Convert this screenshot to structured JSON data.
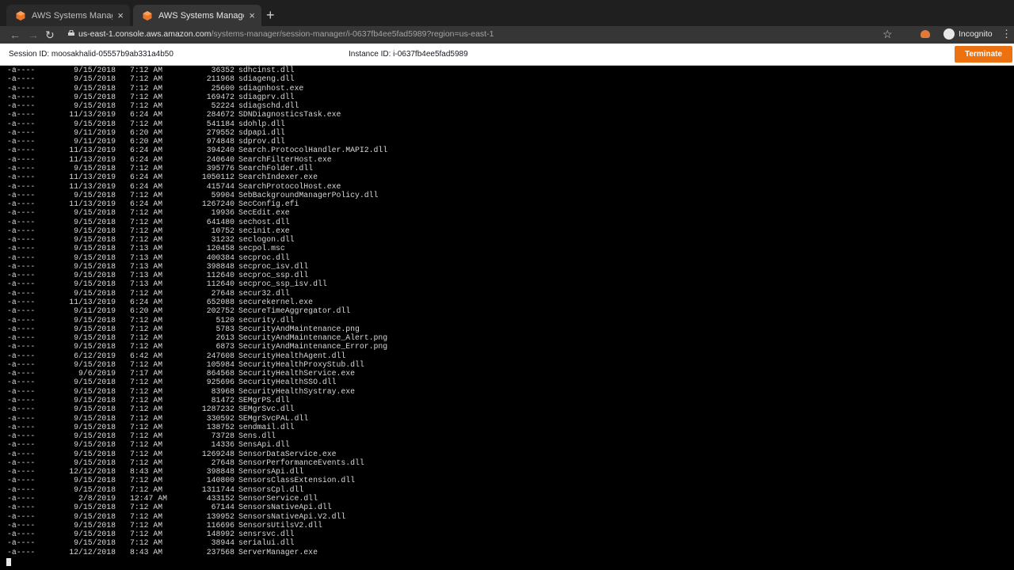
{
  "browser": {
    "tabs": [
      {
        "title": "AWS Systems Manager - Sessi"
      },
      {
        "title": "AWS Systems Manager - Sessi"
      }
    ],
    "new_tab": "+",
    "url_host": "us-east-1.console.aws.amazon.com",
    "url_path": "/systems-manager/session-manager/i-0637fb4ee5fad5989?region=us-east-1",
    "incognito_label": "Incognito"
  },
  "session": {
    "session_label": "Session ID: moosakhalid-05557b9ab331a4b50",
    "instance_label": "Instance ID: i-0637fb4ee5fad5989",
    "terminate_label": "Terminate",
    "accent_color": "#ec7211"
  },
  "terminal": {
    "rows": [
      {
        "mode": "-a----",
        "date": "9/15/2018",
        "time": "7:12 AM",
        "size": "36352",
        "name": "sdhcinst.dll"
      },
      {
        "mode": "-a----",
        "date": "9/15/2018",
        "time": "7:12 AM",
        "size": "211968",
        "name": "sdiageng.dll"
      },
      {
        "mode": "-a----",
        "date": "9/15/2018",
        "time": "7:12 AM",
        "size": "25600",
        "name": "sdiagnhost.exe"
      },
      {
        "mode": "-a----",
        "date": "9/15/2018",
        "time": "7:12 AM",
        "size": "169472",
        "name": "sdiagprv.dll"
      },
      {
        "mode": "-a----",
        "date": "9/15/2018",
        "time": "7:12 AM",
        "size": "52224",
        "name": "sdiagschd.dll"
      },
      {
        "mode": "-a----",
        "date": "11/13/2019",
        "time": "6:24 AM",
        "size": "284672",
        "name": "SDNDiagnosticsTask.exe"
      },
      {
        "mode": "-a----",
        "date": "9/15/2018",
        "time": "7:12 AM",
        "size": "541184",
        "name": "sdohlp.dll"
      },
      {
        "mode": "-a----",
        "date": "9/11/2019",
        "time": "6:20 AM",
        "size": "279552",
        "name": "sdpapi.dll"
      },
      {
        "mode": "-a----",
        "date": "9/11/2019",
        "time": "6:20 AM",
        "size": "974848",
        "name": "sdprov.dll"
      },
      {
        "mode": "-a----",
        "date": "11/13/2019",
        "time": "6:24 AM",
        "size": "394240",
        "name": "Search.ProtocolHandler.MAPI2.dll"
      },
      {
        "mode": "-a----",
        "date": "11/13/2019",
        "time": "6:24 AM",
        "size": "240640",
        "name": "SearchFilterHost.exe"
      },
      {
        "mode": "-a----",
        "date": "9/15/2018",
        "time": "7:12 AM",
        "size": "395776",
        "name": "SearchFolder.dll"
      },
      {
        "mode": "-a----",
        "date": "11/13/2019",
        "time": "6:24 AM",
        "size": "1050112",
        "name": "SearchIndexer.exe"
      },
      {
        "mode": "-a----",
        "date": "11/13/2019",
        "time": "6:24 AM",
        "size": "415744",
        "name": "SearchProtocolHost.exe"
      },
      {
        "mode": "-a----",
        "date": "9/15/2018",
        "time": "7:12 AM",
        "size": "59904",
        "name": "SebBackgroundManagerPolicy.dll"
      },
      {
        "mode": "-a----",
        "date": "11/13/2019",
        "time": "6:24 AM",
        "size": "1267240",
        "name": "SecConfig.efi"
      },
      {
        "mode": "-a----",
        "date": "9/15/2018",
        "time": "7:12 AM",
        "size": "19936",
        "name": "SecEdit.exe"
      },
      {
        "mode": "-a----",
        "date": "9/15/2018",
        "time": "7:12 AM",
        "size": "641480",
        "name": "sechost.dll"
      },
      {
        "mode": "-a----",
        "date": "9/15/2018",
        "time": "7:12 AM",
        "size": "10752",
        "name": "secinit.exe"
      },
      {
        "mode": "-a----",
        "date": "9/15/2018",
        "time": "7:12 AM",
        "size": "31232",
        "name": "seclogon.dll"
      },
      {
        "mode": "-a----",
        "date": "9/15/2018",
        "time": "7:13 AM",
        "size": "120458",
        "name": "secpol.msc"
      },
      {
        "mode": "-a----",
        "date": "9/15/2018",
        "time": "7:13 AM",
        "size": "400384",
        "name": "secproc.dll"
      },
      {
        "mode": "-a----",
        "date": "9/15/2018",
        "time": "7:13 AM",
        "size": "398848",
        "name": "secproc_isv.dll"
      },
      {
        "mode": "-a----",
        "date": "9/15/2018",
        "time": "7:13 AM",
        "size": "112640",
        "name": "secproc_ssp.dll"
      },
      {
        "mode": "-a----",
        "date": "9/15/2018",
        "time": "7:13 AM",
        "size": "112640",
        "name": "secproc_ssp_isv.dll"
      },
      {
        "mode": "-a----",
        "date": "9/15/2018",
        "time": "7:12 AM",
        "size": "27648",
        "name": "secur32.dll"
      },
      {
        "mode": "-a----",
        "date": "11/13/2019",
        "time": "6:24 AM",
        "size": "652088",
        "name": "securekernel.exe"
      },
      {
        "mode": "-a----",
        "date": "9/11/2019",
        "time": "6:20 AM",
        "size": "202752",
        "name": "SecureTimeAggregator.dll"
      },
      {
        "mode": "-a----",
        "date": "9/15/2018",
        "time": "7:12 AM",
        "size": "5120",
        "name": "security.dll"
      },
      {
        "mode": "-a----",
        "date": "9/15/2018",
        "time": "7:12 AM",
        "size": "5783",
        "name": "SecurityAndMaintenance.png"
      },
      {
        "mode": "-a----",
        "date": "9/15/2018",
        "time": "7:12 AM",
        "size": "2613",
        "name": "SecurityAndMaintenance_Alert.png"
      },
      {
        "mode": "-a----",
        "date": "9/15/2018",
        "time": "7:12 AM",
        "size": "6873",
        "name": "SecurityAndMaintenance_Error.png"
      },
      {
        "mode": "-a----",
        "date": "6/12/2019",
        "time": "6:42 AM",
        "size": "247608",
        "name": "SecurityHealthAgent.dll"
      },
      {
        "mode": "-a----",
        "date": "9/15/2018",
        "time": "7:12 AM",
        "size": "105984",
        "name": "SecurityHealthProxyStub.dll"
      },
      {
        "mode": "-a----",
        "date": "9/6/2019",
        "time": "7:17 AM",
        "size": "864568",
        "name": "SecurityHealthService.exe"
      },
      {
        "mode": "-a----",
        "date": "9/15/2018",
        "time": "7:12 AM",
        "size": "925696",
        "name": "SecurityHealthSSO.dll"
      },
      {
        "mode": "-a----",
        "date": "9/15/2018",
        "time": "7:12 AM",
        "size": "83968",
        "name": "SecurityHealthSystray.exe"
      },
      {
        "mode": "-a----",
        "date": "9/15/2018",
        "time": "7:12 AM",
        "size": "81472",
        "name": "SEMgrPS.dll"
      },
      {
        "mode": "-a----",
        "date": "9/15/2018",
        "time": "7:12 AM",
        "size": "1287232",
        "name": "SEMgrSvc.dll"
      },
      {
        "mode": "-a----",
        "date": "9/15/2018",
        "time": "7:12 AM",
        "size": "330592",
        "name": "SEMgrSvcPAL.dll"
      },
      {
        "mode": "-a----",
        "date": "9/15/2018",
        "time": "7:12 AM",
        "size": "138752",
        "name": "sendmail.dll"
      },
      {
        "mode": "-a----",
        "date": "9/15/2018",
        "time": "7:12 AM",
        "size": "73728",
        "name": "Sens.dll"
      },
      {
        "mode": "-a----",
        "date": "9/15/2018",
        "time": "7:12 AM",
        "size": "14336",
        "name": "SensApi.dll"
      },
      {
        "mode": "-a----",
        "date": "9/15/2018",
        "time": "7:12 AM",
        "size": "1269248",
        "name": "SensorDataService.exe"
      },
      {
        "mode": "-a----",
        "date": "9/15/2018",
        "time": "7:12 AM",
        "size": "27648",
        "name": "SensorPerformanceEvents.dll"
      },
      {
        "mode": "-a----",
        "date": "12/12/2018",
        "time": "8:43 AM",
        "size": "398848",
        "name": "SensorsApi.dll"
      },
      {
        "mode": "-a----",
        "date": "9/15/2018",
        "time": "7:12 AM",
        "size": "140800",
        "name": "SensorsClassExtension.dll"
      },
      {
        "mode": "-a----",
        "date": "9/15/2018",
        "time": "7:12 AM",
        "size": "1311744",
        "name": "SensorsCpl.dll"
      },
      {
        "mode": "-a----",
        "date": "2/8/2019",
        "time": "12:47 AM",
        "size": "433152",
        "name": "SensorService.dll"
      },
      {
        "mode": "-a----",
        "date": "9/15/2018",
        "time": "7:12 AM",
        "size": "67144",
        "name": "SensorsNativeApi.dll"
      },
      {
        "mode": "-a----",
        "date": "9/15/2018",
        "time": "7:12 AM",
        "size": "139952",
        "name": "SensorsNativeApi.V2.dll"
      },
      {
        "mode": "-a----",
        "date": "9/15/2018",
        "time": "7:12 AM",
        "size": "116696",
        "name": "SensorsUtilsV2.dll"
      },
      {
        "mode": "-a----",
        "date": "9/15/2018",
        "time": "7:12 AM",
        "size": "148992",
        "name": "sensrsvc.dll"
      },
      {
        "mode": "-a----",
        "date": "9/15/2018",
        "time": "7:12 AM",
        "size": "38944",
        "name": "serialui.dll"
      },
      {
        "mode": "-a----",
        "date": "12/12/2018",
        "time": "8:43 AM",
        "size": "237568",
        "name": "ServerManager.exe"
      }
    ]
  }
}
